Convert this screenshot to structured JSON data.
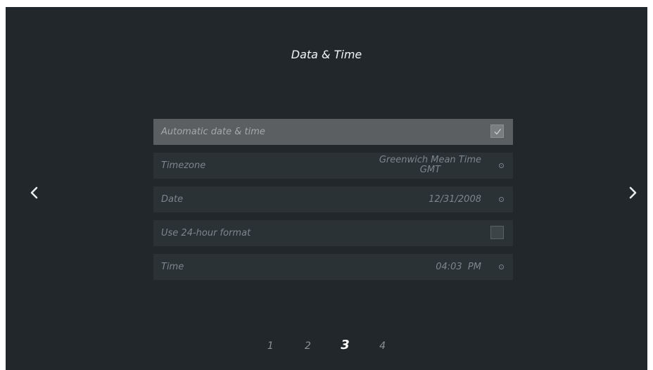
{
  "page": {
    "title": "Data & Time"
  },
  "settings": [
    {
      "label": "Automatic date & time",
      "control": "checkbox",
      "checked": true,
      "selected": true
    },
    {
      "label": "Timezone",
      "value_line1": "Greenwich Mean Time",
      "value_line2": "GMT",
      "control": "dot-icon"
    },
    {
      "label": "Date",
      "value": "12/31/2008",
      "control": "dot-icon"
    },
    {
      "label": "Use 24-hour format",
      "control": "checkbox",
      "checked": false
    },
    {
      "label": "Time",
      "value": "04:03  PM",
      "control": "dot-icon"
    }
  ],
  "pager": {
    "pages": [
      "1",
      "2",
      "3",
      "4"
    ],
    "current": "3"
  },
  "icons": {
    "prev": "chevron-left-icon",
    "next": "chevron-right-icon",
    "checkmark": "checkmark-icon",
    "detail": "dot-icon"
  },
  "colors": {
    "background": "#22272b",
    "row": "#2b3236",
    "row_selected": "#5b5f61",
    "text": "#7d868b",
    "title": "#f2f4f5"
  }
}
